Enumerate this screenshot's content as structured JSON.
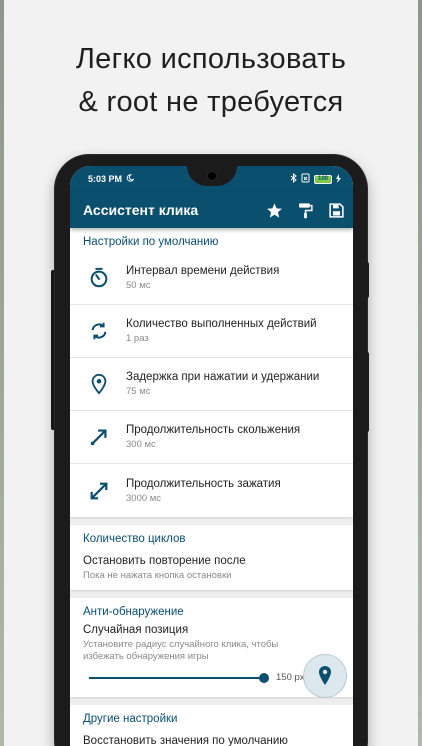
{
  "headline": {
    "line1": "Легко использовать",
    "line2": "& root не требуется"
  },
  "statusbar": {
    "time": "5:03 PM",
    "battery": "100"
  },
  "appbar": {
    "title": "Ассистент клика",
    "icons": [
      "star-icon",
      "paint-roller-icon",
      "save-icon"
    ]
  },
  "defaults": {
    "section_title": "Настройки по умолчанию",
    "items": [
      {
        "icon": "timer-icon",
        "title": "Интервал времени действия",
        "subtitle": "50 мс"
      },
      {
        "icon": "repeat-icon",
        "title": "Количество выполненных действий",
        "subtitle": "1 раз"
      },
      {
        "icon": "location-pin-icon",
        "title": "Задержка при нажатии и удержании",
        "subtitle": "75 мс"
      },
      {
        "icon": "diagonal-arrow-icon",
        "title": "Продолжительность скольжения",
        "subtitle": "300 мс"
      },
      {
        "icon": "expand-arrows-icon",
        "title": "Продолжительность зажатия",
        "subtitle": "3000 мс"
      }
    ]
  },
  "cycles": {
    "section_title": "Количество циклов",
    "title": "Остановить повторение после",
    "subtitle": "Пока не нажата кнопка остановки"
  },
  "anti_detection": {
    "section_title": "Анти-обнаружение",
    "title": "Случайная позиция",
    "subtitle": "Установите радиус случайного клика, чтобы избежать обнаружения игры",
    "slider_value": "150 px",
    "slider_fraction": 1.0
  },
  "other": {
    "section_title": "Другие настройки",
    "first_item": "Восстановить значения по умолчанию"
  },
  "colors": {
    "primary": "#0a4f6e",
    "battery": "#7ec84a"
  }
}
